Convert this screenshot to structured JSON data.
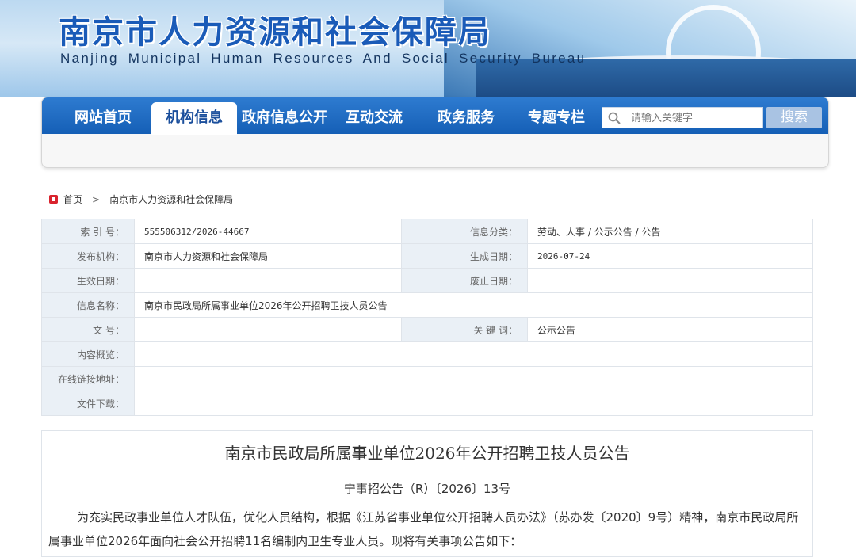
{
  "header": {
    "title": "南京市人力资源和社会保障局",
    "subtitle": "Nanjing Municipal Human Resources And Social Security Bureau"
  },
  "nav": {
    "items": [
      {
        "label": "网站首页"
      },
      {
        "label": "机构信息"
      },
      {
        "label": "政府信息公开"
      },
      {
        "label": "互动交流"
      },
      {
        "label": "政务服务"
      },
      {
        "label": "专题专栏"
      }
    ],
    "active_index": 1,
    "search_placeholder": "请输入关键字",
    "search_button": "搜索"
  },
  "breadcrumb": {
    "home": "首页",
    "separator": ">",
    "current": "南京市人力资源和社会保障局"
  },
  "info": {
    "index_label": "索  引  号：",
    "index_value": "555506312/2026-44667",
    "category_label": "信息分类：",
    "category_value": "劳动、人事 / 公示公告 / 公告",
    "publisher_label": "发布机构：",
    "publisher_value": "南京市人力资源和社会保障局",
    "created_label": "生成日期：",
    "created_value": "2026-07-24",
    "effective_label": "生效日期：",
    "effective_value": "",
    "abolished_label": "废止日期：",
    "abolished_value": "",
    "name_label": "信息名称：",
    "name_value": "南京市民政局所属事业单位2026年公开招聘卫技人员公告",
    "docno_label": "文       号：",
    "docno_value": "",
    "keywords_label": "关  键  词：",
    "keywords_value": "公示公告",
    "overview_label": "内容概览：",
    "overview_value": "",
    "link_label": "在线链接地址：",
    "link_value": "",
    "download_label": "文件下载：",
    "download_value": ""
  },
  "article": {
    "title": "南京市民政局所属事业单位2026年公开招聘卫技人员公告",
    "doc_number": "宁事招公告（R）〔2026〕13号",
    "paragraph": "为充实民政事业单位人才队伍，优化人员结构，根据《江苏省事业单位公开招聘人员办法》（苏办发〔2020〕9号）精神，南京市民政局所属事业单位2026年面向社会公开招聘11名编制内卫生专业人员。现将有关事项公告如下："
  },
  "colors": {
    "nav_blue": "#1b65bd",
    "title_blue": "#1a5bb8",
    "label_bg": "#eaf0f6",
    "home_red": "#d9232d"
  }
}
